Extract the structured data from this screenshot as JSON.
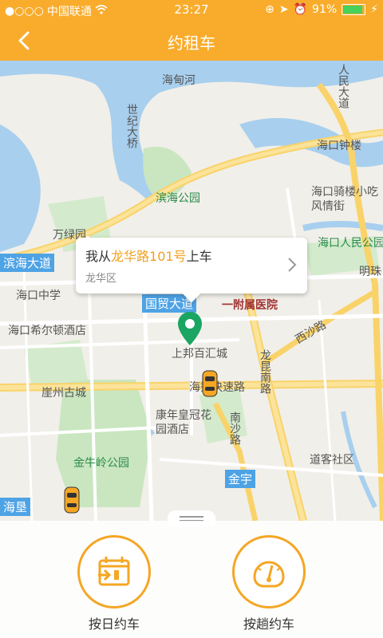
{
  "status_bar": {
    "carrier": "中国联通",
    "time": "23:27",
    "battery": "91%",
    "battery_level": 0.91
  },
  "nav": {
    "title": "约租车",
    "back_icon": "chevron-left-icon"
  },
  "map": {
    "labels": [
      {
        "text": "海甸河",
        "class": ""
      },
      {
        "text": "人民大道",
        "class": ""
      },
      {
        "text": "世纪大桥",
        "class": ""
      },
      {
        "text": "海口钟楼",
        "class": ""
      },
      {
        "text": "滨海公园",
        "class": "green"
      },
      {
        "text": "海口骑楼小吃风情街",
        "class": ""
      },
      {
        "text": "万绿园",
        "class": ""
      },
      {
        "text": "海口人民公园",
        "class": "green"
      },
      {
        "text": "滨海大道",
        "class": "badge"
      },
      {
        "text": "明珠",
        "class": ""
      },
      {
        "text": "海口中学",
        "class": ""
      },
      {
        "text": "国贸大道",
        "class": "badge"
      },
      {
        "text": "一附属医院",
        "class": "red"
      },
      {
        "text": "海口希尔顿酒店",
        "class": ""
      },
      {
        "text": "西沙路",
        "class": ""
      },
      {
        "text": "上邦百汇城",
        "class": ""
      },
      {
        "text": "龙昆南路",
        "class": ""
      },
      {
        "text": "崖州古城",
        "class": ""
      },
      {
        "text": "海秀快速路",
        "class": ""
      },
      {
        "text": "康年皇冠花园酒店",
        "class": ""
      },
      {
        "text": "南沙路",
        "class": ""
      },
      {
        "text": "金牛岭公园",
        "class": "green"
      },
      {
        "text": "道客社区",
        "class": ""
      },
      {
        "text": "金宇",
        "class": "badge"
      },
      {
        "text": "海垦",
        "class": "badge"
      }
    ]
  },
  "callout": {
    "prefix": "我从",
    "place": "龙华路101号",
    "suffix": "上车",
    "district": "龙华区"
  },
  "actions": [
    {
      "label": "按日约车",
      "icon": "calendar-arrow-icon"
    },
    {
      "label": "按趟约车",
      "icon": "speedometer-icon"
    }
  ]
}
